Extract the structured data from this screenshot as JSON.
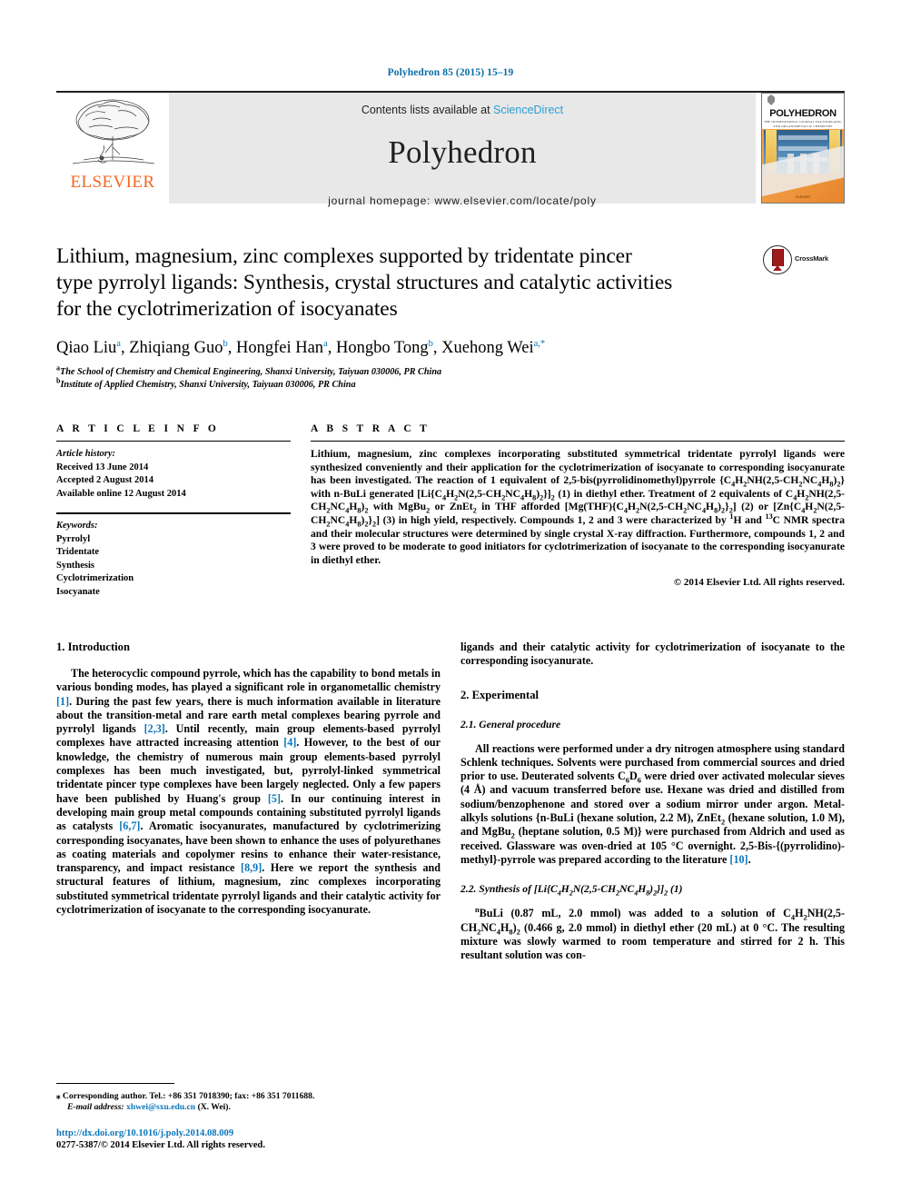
{
  "running_head": "Polyhedron 85 (2015) 15–19",
  "masthead": {
    "contents_prefix": "Contents lists available at ",
    "sciencedirect": "ScienceDirect",
    "journal_name": "Polyhedron",
    "homepage": "journal homepage: www.elsevier.com/locate/poly",
    "publisher_logo_text": "ELSEVIER",
    "cover": {
      "title": "POLYHEDRON",
      "subtitle": "THE INTERNATIONAL JOURNAL FOR INORGANIC AND ORGANOMETALLIC CHEMISTRY",
      "footer": "ELSEVIER"
    }
  },
  "article": {
    "title_line1": "Lithium, magnesium, zinc complexes supported by tridentate pincer",
    "title_line2": "type pyrrolyl ligands: Synthesis, crystal structures and catalytic activities",
    "title_line3": "for the cyclotrimerization of isocyanates",
    "crossmark_label": "CrossMark",
    "authors": [
      {
        "name": "Qiao Liu",
        "marks": "a"
      },
      {
        "name": "Zhiqiang Guo",
        "marks": "b"
      },
      {
        "name": "Hongfei Han",
        "marks": "a"
      },
      {
        "name": "Hongbo Tong",
        "marks": "b"
      },
      {
        "name": "Xuehong Wei",
        "marks": "a,*"
      }
    ],
    "affiliations": [
      {
        "mark": "a",
        "text": "The School of Chemistry and Chemical Engineering, Shanxi University, Taiyuan 030006, PR China"
      },
      {
        "mark": "b",
        "text": "Institute of Applied Chemistry, Shanxi University, Taiyuan 030006, PR China"
      }
    ]
  },
  "article_info": {
    "heading": "A R T I C L E   I N F O",
    "history_label": "Article history:",
    "history": [
      "Received 13 June 2014",
      "Accepted 2 August 2014",
      "Available online 12 August 2014"
    ],
    "keywords_label": "Keywords:",
    "keywords": [
      "Pyrrolyl",
      "Tridentate",
      "Synthesis",
      "Cyclotrimerization",
      "Isocyanate"
    ]
  },
  "abstract": {
    "heading": "A B S T R A C T",
    "paragraph_html": "Lithium, magnesium, zinc complexes incorporating substituted symmetrical tridentate pyrrolyl ligands were synthesized conveniently and their application for the cyclotrimerization of isocyanate to corresponding isocyanurate has been investigated. The reaction of 1 equivalent of 2,5-bis(pyrrolidinomethyl)pyrrole {C<sub>4</sub>H<sub>2</sub>NH(2,5-CH<sub>2</sub>NC<sub>4</sub>H<sub>8</sub>)<sub>2</sub>} with n-BuLi generated [Li{C<sub>4</sub>H<sub>2</sub>N(2,5-CH<sub>2</sub>NC<sub>4</sub>H<sub>8</sub>)<sub>2</sub>}]<sub>2</sub> (1) in diethyl ether. Treatment of 2 equivalents of C<sub>4</sub>H<sub>2</sub>NH(2,5-CH<sub>2</sub>NC<sub>4</sub>H<sub>8</sub>)<sub>2</sub> with MgBu<sub>2</sub> or ZnEt<sub>2</sub> in THF afforded [Mg(THF){C<sub>4</sub>H<sub>2</sub>N(2,5-CH<sub>2</sub>NC<sub>4</sub>H<sub>8</sub>)<sub>2</sub>}<sub>2</sub>] (2) or [Zn{C<sub>4</sub>H<sub>2</sub>N(2,5-CH<sub>2</sub>NC<sub>4</sub>H<sub>8</sub>)<sub>2</sub>}<sub>2</sub>] (3) in high yield, respectively. Compounds <b>1</b>, <b>2</b> and <b>3</b> were characterized by <sup>1</sup>H and <sup>13</sup>C NMR spectra and their molecular structures were determined by single crystal X-ray diffraction. Furthermore, compounds <b>1</b>, <b>2</b> and <b>3</b> were proved to be moderate to good initiators for cyclotrimerization of isocyanate to the corresponding isocyanurate in diethyl ether.",
    "copyright": "© 2014 Elsevier Ltd. All rights reserved."
  },
  "body": {
    "intro_heading": "1. Introduction",
    "intro_paragraph_html": "The heterocyclic compound pyrrole, which has the capability to bond metals in various bonding modes, has played a significant role in organometallic chemistry <span class=\"ref\">[1]</span>. During the past few years, there is much information available in literature about the transition-metal and rare earth metal complexes bearing pyrrole and pyrrolyl ligands <span class=\"ref\">[2,3]</span>. Until recently, main group elements-based pyrrolyl complexes have attracted increasing attention <span class=\"ref\">[4]</span>. However, to the best of our knowledge, the chemistry of numerous main group elements-based pyrrolyl complexes has been much investigated, but, pyrrolyl-linked symmetrical tridentate pincer type complexes have been largely neglected. Only a few papers have been published by Huang's group <span class=\"ref\">[5]</span>. In our continuing interest in developing main group metal compounds containing substituted pyrrolyl ligands as catalysts <span class=\"ref\">[6,7]</span>. Aromatic isocyanurates, manufactured by cyclotrimerizing corresponding isocyanates, have been shown to enhance the uses of polyurethanes as coating materials and copolymer resins to enhance their water-resistance, transparency, and impact resistance <span class=\"ref\">[8,9]</span>. Here we report the synthesis and structural features of lithium, magnesium, zinc complexes incorporating substituted symmetrical tridentate pyrrolyl ligands and their catalytic activity for cyclotrimerization of isocyanate to the corresponding isocyanurate.",
    "intro_continuation_html": "ligands and their catalytic activity for cyclotrimerization of isocyanate to the corresponding isocyanurate.",
    "experimental_heading": "2. Experimental",
    "general_subheading": "2.1. General procedure",
    "general_paragraph_html": "All reactions were performed under a dry nitrogen atmosphere using standard Schlenk techniques. Solvents were purchased from commercial sources and dried prior to use. Deuterated solvents C<sub>6</sub>D<sub>6</sub> were dried over activated molecular sieves (4 Å) and vacuum transferred before use. Hexane was dried and distilled from sodium/benzophenone and stored over a sodium mirror under argon. Metal-alkyls solutions {n-BuLi (hexane solution, 2.2 M), ZnEt<sub>2</sub> (hexane solution, 1.0 M), and MgBu<sub>2</sub> (heptane solution, 0.5 M)} were purchased from Aldrich and used as received. Glassware was oven-dried at 105 °C overnight. 2,5-Bis-{(pyrrolidino)-methyl}-pyrrole was prepared according to the literature <span class=\"ref\">[10]</span>.",
    "synthesis_subheading_html": "2.2. Synthesis of [Li{C<sub>4</sub>H<sub>2</sub>N(2,5-CH<sub>2</sub>NC<sub>4</sub>H<sub>8</sub>)<sub>2</sub>}]<sub>2</sub> (<b>1</b>)",
    "synthesis_paragraph_html": "<sup>n</sup>BuLi (0.87 mL, 2.0 mmol) was added to a solution of C<sub>4</sub>H<sub>2</sub>NH(2,5-CH<sub>2</sub>NC<sub>4</sub>H<sub>8</sub>)<sub>2</sub> (0.466 g, 2.0 mmol) in diethyl ether (20 mL) at 0 °C. The resulting mixture was slowly warmed to room temperature and stirred for 2 h. This resultant solution was con-"
  },
  "footer": {
    "corresponding_star": "⁎",
    "corresponding_text": "Corresponding author. Tel.: +86 351 7018390; fax: +86 351 7011688.",
    "email_label": "E-mail address:",
    "email": "xhwei@sxu.edu.cn",
    "email_suffix": "(X. Wei).",
    "doi": "http://dx.doi.org/10.1016/j.poly.2014.08.009",
    "issn": "0277-5387/© 2014 Elsevier Ltd. All rights reserved."
  },
  "colors": {
    "link": "#0b76bc",
    "elsevier_orange": "#f26722",
    "masthead_bg": "#e8e8e8"
  }
}
